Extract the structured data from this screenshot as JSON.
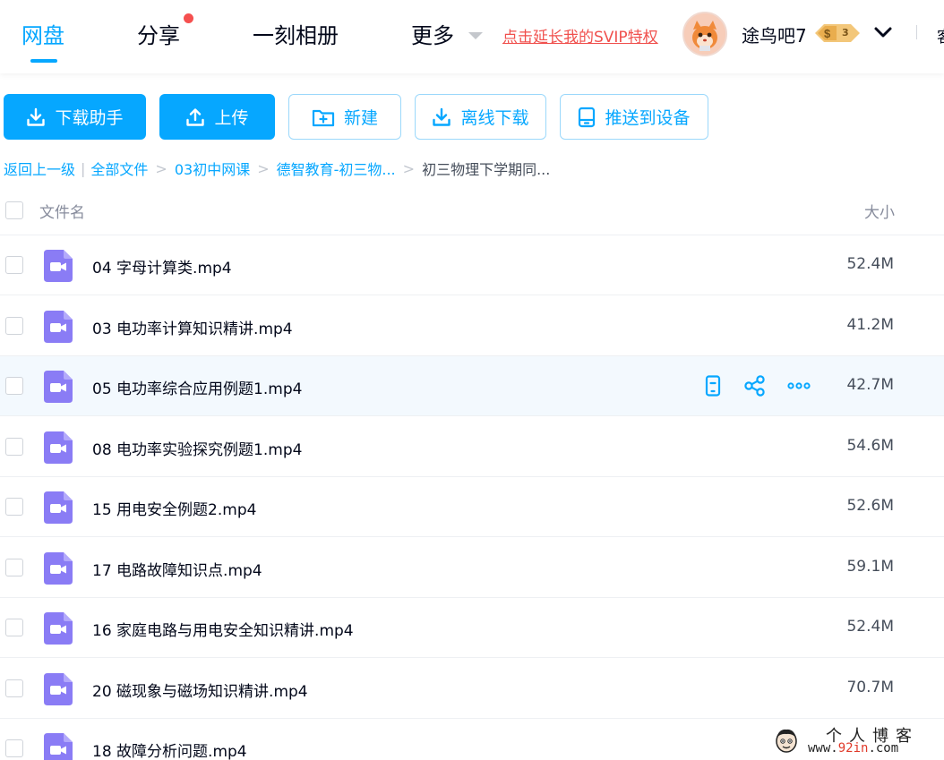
{
  "nav": {
    "tabs": [
      {
        "label": "网盘",
        "active": true
      },
      {
        "label": "分享",
        "active": false,
        "has_dot": true
      },
      {
        "label": "一刻相册",
        "active": false
      },
      {
        "label": "更多",
        "active": false,
        "has_caret": true
      }
    ],
    "svip_link": "点击延长我的SVIP特权",
    "username": "途鸟吧7",
    "level": "3",
    "cut_text": "客",
    "colors": {
      "accent": "#06a7ff",
      "svip_link": "#f0504d",
      "notify_dot": "#f5504f"
    }
  },
  "toolbar": {
    "buttons": [
      {
        "label": "下载助手",
        "icon": "download-icon",
        "style": "primary"
      },
      {
        "label": "上传",
        "icon": "upload-icon",
        "style": "primary"
      },
      {
        "label": "新建",
        "icon": "new-folder-icon",
        "style": "outline"
      },
      {
        "label": "离线下载",
        "icon": "download-icon",
        "style": "outline"
      },
      {
        "label": "推送到设备",
        "icon": "device-icon",
        "style": "outline"
      }
    ]
  },
  "breadcrumb": {
    "back": "返回上一级",
    "items": [
      "全部文件",
      "03初中网课",
      "德智教育-初三物...",
      "初三物理下学期同..."
    ]
  },
  "table": {
    "headers": {
      "name": "文件名",
      "size": "大小"
    },
    "rows": [
      {
        "name": "04 字母计算类.mp4",
        "size": "52.4M"
      },
      {
        "name": "03 电功率计算知识精讲.mp4",
        "size": "41.2M"
      },
      {
        "name": "05 电功率综合应用例题1.mp4",
        "size": "42.7M",
        "hover": true
      },
      {
        "name": "08 电功率实验探究例题1.mp4",
        "size": "54.6M"
      },
      {
        "name": "15 用电安全例题2.mp4",
        "size": "52.6M"
      },
      {
        "name": "17 电路故障知识点.mp4",
        "size": "59.1M"
      },
      {
        "name": "16 家庭电路与用电安全知识精讲.mp4",
        "size": "52.4M"
      },
      {
        "name": "20 磁现象与磁场知识精讲.mp4",
        "size": "70.7M"
      },
      {
        "name": "18 故障分析问题.mp4",
        "size": ""
      }
    ],
    "row_actions": [
      "push-to-device-icon",
      "share-icon",
      "more-icon"
    ],
    "file_icon": "video-file-icon",
    "file_icon_color": "#8a7cf5"
  },
  "watermark": {
    "title": "个人博客",
    "url_prefix": "www.",
    "url_accent": "92in",
    "url_suffix": ".com"
  }
}
